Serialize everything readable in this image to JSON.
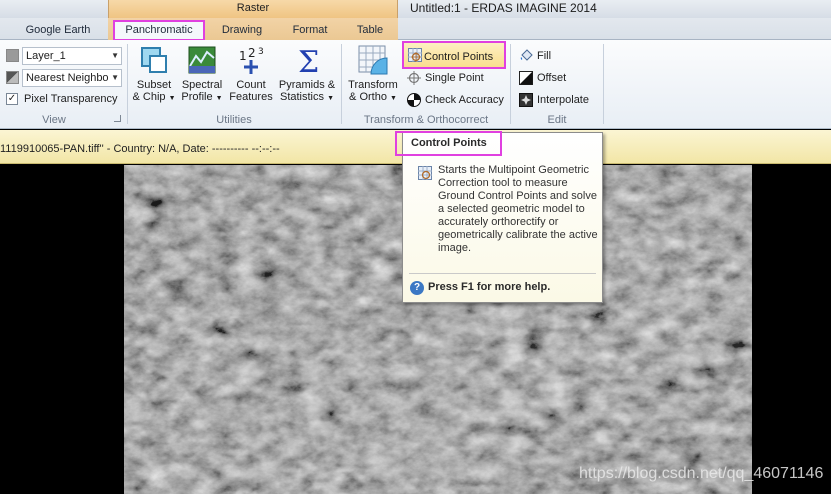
{
  "titlebar": {
    "context_group_title": "Raster",
    "app_title": "Untitled:1 - ERDAS IMAGINE 2014"
  },
  "tabs": {
    "google_earth": "Google Earth",
    "panchromatic": "Panchromatic",
    "drawing": "Drawing",
    "format": "Format",
    "table": "Table"
  },
  "ribbon": {
    "view": {
      "layer_select": "Layer_1",
      "resample_select": "Nearest Neighbo",
      "pixel_transparency_label": "Pixel Transparency",
      "pixel_transparency_checked": true,
      "group_label": "View"
    },
    "utilities": {
      "subset_chip_line1": "Subset",
      "subset_chip_line2": "& Chip",
      "spectral_profile_line1": "Spectral",
      "spectral_profile_line2": "Profile",
      "count_features_line1": "Count",
      "count_features_line2": "Features",
      "pyramids_line1": "Pyramids &",
      "pyramids_line2": "Statistics",
      "group_label": "Utilities"
    },
    "transform": {
      "transform_ortho_line1": "Transform",
      "transform_ortho_line2": "& Ortho",
      "control_points": "Control Points",
      "single_point": "Single Point",
      "check_accuracy": "Check Accuracy",
      "group_label": "Transform & Orthocorrect"
    },
    "edit": {
      "fill": "Fill",
      "offset": "Offset",
      "interpolate": "Interpolate",
      "group_label": "Edit"
    }
  },
  "status": {
    "text": "1119910065-PAN.tiff'' - Country: N/A, Date: ---------- --:--:--"
  },
  "tooltip": {
    "title": "Control Points",
    "description": "Starts the Multipoint Geometric Correction tool to measure Ground Control Points and solve a selected geometric model to accurately orthorectify or geometrically calibrate the active image.",
    "help": "Press F1 for more help."
  },
  "watermark": "https://blog.csdn.net/qq_46071146",
  "colors": {
    "highlight_border": "#e040e0",
    "context_tab": "#efc483",
    "status_bg": "#f2e6a6"
  },
  "icons": {
    "subset_chip": "subset-chip-icon",
    "spectral_profile": "spectral-profile-icon",
    "count_features": "count-features-icon",
    "pyramids_statistics": "sigma-icon",
    "transform_ortho": "grid-globe-icon",
    "control_points": "gcp-grid-icon",
    "single_point": "crosshair-icon",
    "check_accuracy": "target-icon",
    "fill": "paint-bucket-icon",
    "offset": "offset-icon",
    "interpolate": "interpolate-icon",
    "help": "help-circle-icon"
  }
}
